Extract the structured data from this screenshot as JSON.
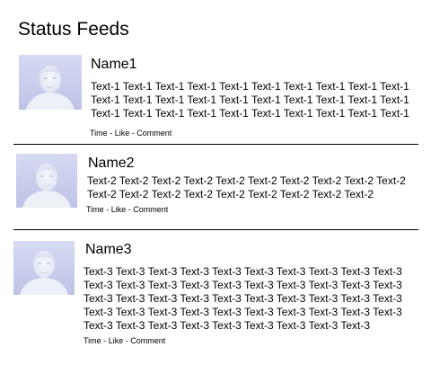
{
  "page": {
    "title": "Status Feeds"
  },
  "posts": [
    {
      "name": "Name1",
      "text": "Text-1 Text-1 Text-1 Text-1 Text-1 Text-1 Text-1 Text-1 Text-1 Text-1 Text-1 Text-1 Text-1 Text-1 Text-1 Text-1 Text-1 Text-1 Text-1 Text-1 Text-1 Text-1 Text-1 Text-1 Text-1 Text-1 Text-1 Text-1 Text-1 Text-1",
      "time_label": "Time",
      "like_label": "Like",
      "comment_label": "Comment",
      "separator": "-",
      "avatar_icon": "person-avatar-icon"
    },
    {
      "name": "Name2",
      "text": "Text-2 Text-2 Text-2 Text-2 Text-2 Text-2 Text-2 Text-2 Text-2 Text-2 Text-2 Text-2 Text-2 Text-2 Text-2 Text-2 Text-2 Text-2 Text-2",
      "time_label": "Time",
      "like_label": "Like",
      "comment_label": "Comment",
      "separator": "-",
      "avatar_icon": "person-avatar-icon"
    },
    {
      "name": "Name3",
      "text": "Text-3 Text-3 Text-3 Text-3 Text-3 Text-3 Text-3 Text-3 Text-3 Text-3 Text-3 Text-3 Text-3 Text-3 Text-3 Text-3 Text-3 Text-3 Text-3 Text-3 Text-3 Text-3 Text-3 Text-3 Text-3 Text-3 Text-3 Text-3 Text-3 Text-3 Text-3 Text-3 Text-3 Text-3 Text-3 Text-3 Text-3 Text-3 Text-3 Text-3 Text-3 Text-3 Text-3 Text-3 Text-3 Text-3 Text-3 Text-3 Text-3",
      "time_label": "Time",
      "like_label": "Like",
      "comment_label": "Comment",
      "separator": "-",
      "avatar_icon": "person-avatar-icon"
    }
  ],
  "colors": {
    "avatar_background": "#c7cbea",
    "divider": "#000000",
    "text": "#000000"
  }
}
